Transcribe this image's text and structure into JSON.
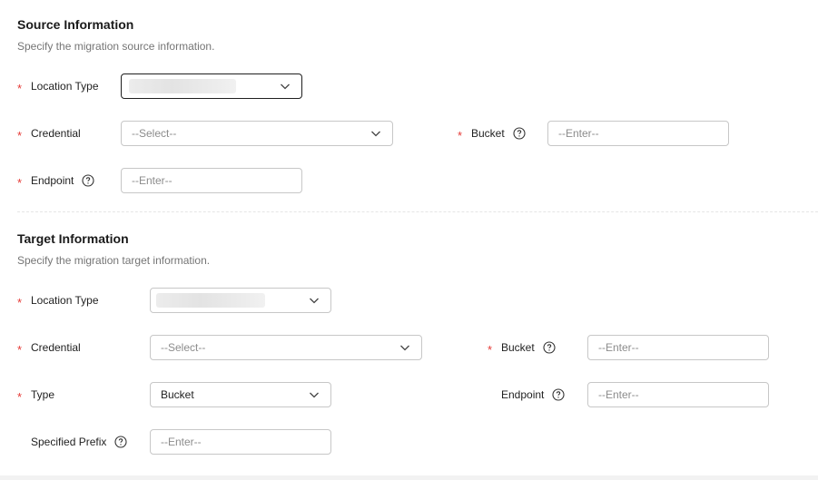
{
  "source": {
    "title": "Source Information",
    "description": "Specify the migration source information.",
    "location_type_label": "Location Type",
    "credential_label": "Credential",
    "credential_placeholder": "--Select--",
    "bucket_label": "Bucket",
    "bucket_placeholder": "--Enter--",
    "endpoint_label": "Endpoint",
    "endpoint_placeholder": "--Enter--"
  },
  "target": {
    "title": "Target Information",
    "description": "Specify the migration target information.",
    "location_type_label": "Location Type",
    "credential_label": "Credential",
    "credential_placeholder": "--Select--",
    "bucket_label": "Bucket",
    "bucket_placeholder": "--Enter--",
    "type_label": "Type",
    "type_value": "Bucket",
    "endpoint_label": "Endpoint",
    "endpoint_placeholder": "--Enter--",
    "prefix_label": "Specified Prefix",
    "prefix_placeholder": "--Enter--"
  },
  "required_marker": "*",
  "icons": {
    "help": "question-circle-icon",
    "dropdown": "chevron-down-icon"
  },
  "colors": {
    "required": "#e53935",
    "border": "#c7c7c7",
    "border_active": "#1f1f1f",
    "placeholder": "#8c8c8c"
  }
}
